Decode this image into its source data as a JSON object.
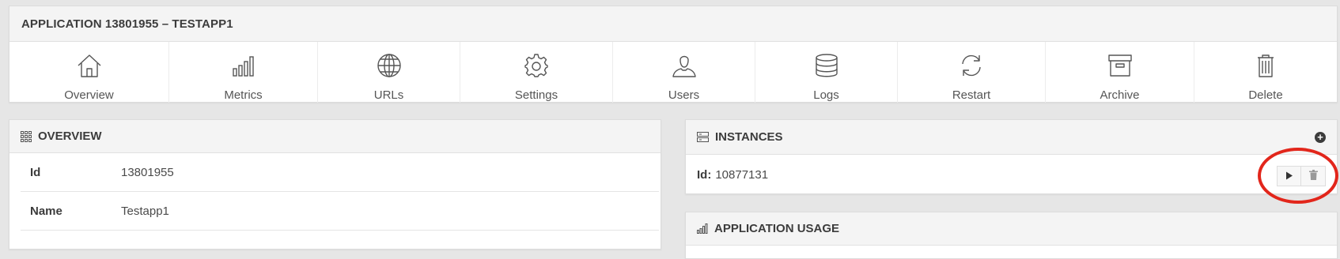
{
  "app_header": {
    "title": "APPLICATION 13801955 – TESTAPP1",
    "toolbar": [
      {
        "label": "Overview",
        "icon": "home-icon"
      },
      {
        "label": "Metrics",
        "icon": "bar-chart-icon"
      },
      {
        "label": "URLs",
        "icon": "globe-icon"
      },
      {
        "label": "Settings",
        "icon": "gear-icon"
      },
      {
        "label": "Users",
        "icon": "user-icon"
      },
      {
        "label": "Logs",
        "icon": "database-icon"
      },
      {
        "label": "Restart",
        "icon": "refresh-icon"
      },
      {
        "label": "Archive",
        "icon": "archive-icon"
      },
      {
        "label": "Delete",
        "icon": "trash-icon"
      }
    ]
  },
  "overview": {
    "title": "OVERVIEW",
    "icon": "grid-icon",
    "rows": [
      {
        "key": "Id",
        "value": "13801955"
      },
      {
        "key": "Name",
        "value": "Testapp1"
      }
    ]
  },
  "instances": {
    "title": "INSTANCES",
    "icon": "server-icon",
    "add_icon": "plus-circle-icon",
    "items": [
      {
        "id_label": "Id:",
        "id_value": "10877131"
      }
    ],
    "actions": [
      "play-icon",
      "trash-icon"
    ]
  },
  "usage": {
    "title": "APPLICATION USAGE",
    "icon": "bar-chart-icon"
  },
  "colors": {
    "highlight": "#e2261b",
    "background": "#e6e6e6",
    "panel_head": "#f4f4f4"
  }
}
